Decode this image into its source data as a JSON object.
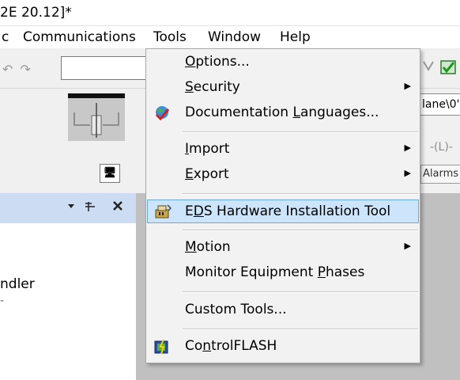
{
  "window": {
    "title": "2E 20.12]*"
  },
  "menubar": {
    "items": [
      "c",
      "Communications",
      "Tools",
      "Window",
      "Help"
    ]
  },
  "toolbar": {
    "combo_value": ""
  },
  "left_panel": {
    "button_glyph": "🖥"
  },
  "side_pane": {
    "controls": "▾ ꟷ ✕",
    "visible_text": "ndler",
    "visible_text2": "-"
  },
  "right_strip": {
    "route_text": "lane\\0'",
    "coil_label": "-(L)-",
    "tab_alarms": "Alarms"
  },
  "tools_menu": {
    "items": [
      {
        "pre": "",
        "u": "O",
        "post": "ptions...",
        "submenu": false
      },
      {
        "pre": "",
        "u": "S",
        "post": "ecurity",
        "submenu": true
      },
      {
        "pre": "Documentation ",
        "u": "L",
        "post": "anguages...",
        "submenu": false,
        "icon": "globe-check-icon"
      },
      {
        "pre": "",
        "u": "I",
        "post": "mport",
        "submenu": true
      },
      {
        "pre": "",
        "u": "E",
        "post": "xport",
        "submenu": true
      },
      {
        "pre": "E",
        "u": "D",
        "post": "S Hardware Installation Tool",
        "submenu": false,
        "icon": "eds-hardware-icon",
        "highlighted": true
      },
      {
        "pre": "",
        "u": "M",
        "post": "otion",
        "submenu": true
      },
      {
        "pre": "Monitor Equipment ",
        "u": "P",
        "post": "hases",
        "submenu": false
      },
      {
        "pre": "Custom Tools...",
        "u": "",
        "post": "",
        "submenu": false
      },
      {
        "pre": "Co",
        "u": "n",
        "post": "trolFLASH",
        "submenu": false,
        "icon": "controlflash-icon"
      }
    ]
  },
  "colors": {
    "highlight_bg": "#cce5fb",
    "highlight_border": "#6aa8e0",
    "pane_header": "#ccdcf2"
  }
}
